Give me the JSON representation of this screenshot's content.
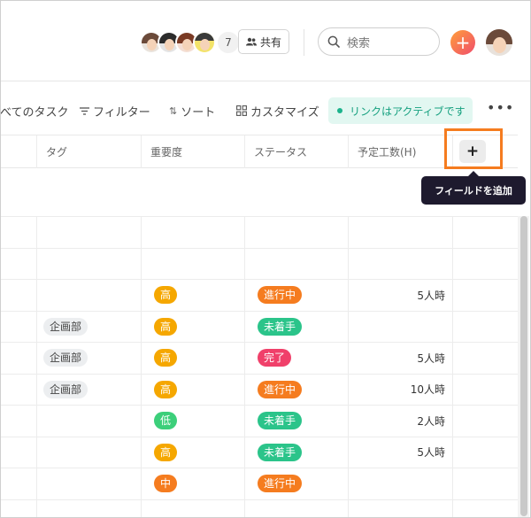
{
  "header": {
    "avatar_count": "7",
    "share_label": "共有",
    "search_placeholder": "検索"
  },
  "toolbar": {
    "all_tasks": "べてのタスク",
    "filter": "フィルター",
    "sort": "ソート",
    "customize": "カスタマイズ",
    "link_status": "リンクはアクティブです"
  },
  "columns": {
    "tag": "タグ",
    "priority": "重要度",
    "status": "ステータス",
    "hours": "予定工数(H)"
  },
  "add_field": {
    "button": "+",
    "tooltip": "フィールドを追加"
  },
  "rows": [
    {
      "tag": "",
      "priority": "",
      "status": "",
      "hours": ""
    },
    {
      "tag": "",
      "priority": "",
      "status": "",
      "hours": ""
    },
    {
      "tag": "",
      "priority": "高",
      "status": "進行中",
      "hours": "5人時"
    },
    {
      "tag": "企画部",
      "priority": "高",
      "status": "未着手",
      "hours": ""
    },
    {
      "tag": "企画部",
      "priority": "高",
      "status": "完了",
      "hours": "5人時"
    },
    {
      "tag": "企画部",
      "priority": "高",
      "status": "進行中",
      "hours": "10人時"
    },
    {
      "tag": "",
      "priority": "低",
      "status": "未着手",
      "hours": "2人時"
    },
    {
      "tag": "",
      "priority": "高",
      "status": "未着手",
      "hours": "5人時"
    },
    {
      "tag": "",
      "priority": "中",
      "status": "進行中",
      "hours": ""
    },
    {
      "tag": "",
      "priority": "",
      "status": "",
      "hours": ""
    }
  ],
  "colors": {
    "priority": {
      "高": "#f5a700",
      "中": "#f57c1f",
      "低": "#3ccf7a"
    },
    "status": {
      "進行中": "#f57c1f",
      "未着手": "#2bc48a",
      "完了": "#f0406a"
    },
    "highlight": "#f57c1f",
    "link_active": "#15a07f"
  }
}
